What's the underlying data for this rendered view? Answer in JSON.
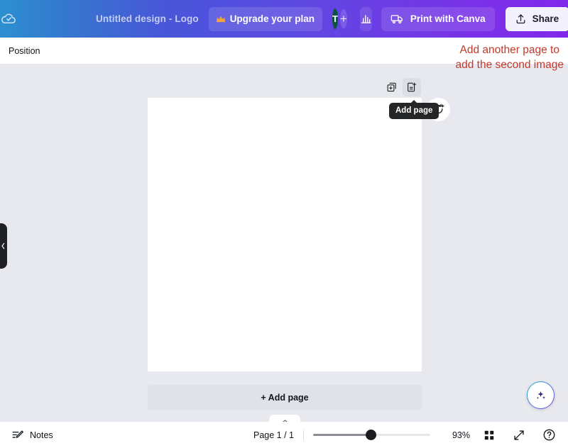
{
  "topbar": {
    "home_icon": "canva-cloud-logo-icon",
    "design_title": "Untitled design - Logo",
    "upgrade_label": "Upgrade your plan",
    "upgrade_icon": "crown-icon",
    "crown_glyph": "♛",
    "avatar_initial": "T",
    "avatar_color": "#0c5440",
    "add_collaborator_label": "+",
    "insights_icon": "bar-chart-icon",
    "print_label": "Print with Canva",
    "print_icon": "delivery-truck-icon",
    "share_label": "Share",
    "share_icon": "upload-arrow-icon"
  },
  "toolbar": {
    "position_label": "Position"
  },
  "stage": {
    "annotation_line1": "Add another page to",
    "annotation_line2": "add the second image",
    "annotation_color": "#c0392b",
    "duplicate_page_icon": "duplicate-page-icon",
    "add_page_icon": "add-page-icon",
    "tooltip_label": "Add page",
    "animate_icon": "animate-refresh-plus-icon",
    "add_page_button_label": "+ Add page",
    "collapse_panel_icon": "chevron-up-icon",
    "sidebar_collapse_icon": "chevron-left-icon",
    "magic_studio_icon": "sparkles-icon",
    "canvas_background": "#ffffff",
    "stage_background": "#e8e9ee"
  },
  "bottombar": {
    "notes_label": "Notes",
    "notes_icon": "notes-pencil-icon",
    "page_indicator": "Page 1 / 1",
    "zoom_level": "93%",
    "grid_view_icon": "grid-view-icon",
    "fullscreen_icon": "expand-diagonal-icon",
    "help_icon": "help-question-icon"
  }
}
